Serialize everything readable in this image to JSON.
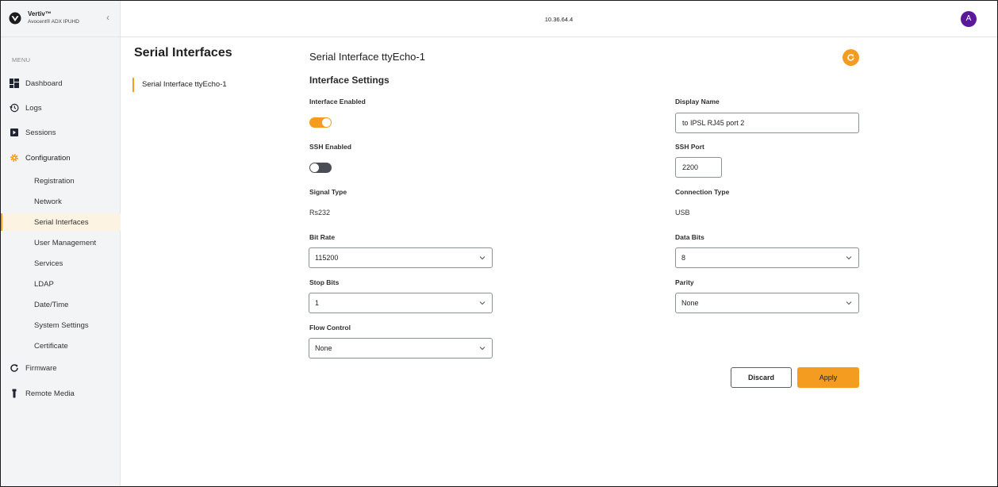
{
  "brand": {
    "name": "Vertiv™",
    "product": "Avocent® ADX IPUHD"
  },
  "topbar": {
    "host": "10.36.64.4",
    "avatar_initial": "A"
  },
  "sidebar": {
    "menu_label": "MENU",
    "items": [
      {
        "label": "Dashboard",
        "icon": "dashboard-icon"
      },
      {
        "label": "Logs",
        "icon": "history-icon"
      },
      {
        "label": "Sessions",
        "icon": "sessions-icon"
      },
      {
        "label": "Configuration",
        "icon": "gear-icon"
      },
      {
        "label": "Firmware",
        "icon": "refresh-icon"
      },
      {
        "label": "Remote Media",
        "icon": "usb-icon"
      }
    ],
    "config_items": [
      "Registration",
      "Network",
      "Serial Interfaces",
      "User Management",
      "Services",
      "LDAP",
      "Date/Time",
      "System Settings",
      "Certificate"
    ],
    "active_item": "Serial Interfaces"
  },
  "page": {
    "section_title": "Serial Interfaces",
    "subnav": [
      "Serial Interface ttyEcho-1"
    ],
    "interface_title": "Serial Interface ttyEcho-1",
    "settings_heading": "Interface Settings"
  },
  "form": {
    "interface_enabled": {
      "label": "Interface Enabled",
      "value": true
    },
    "display_name": {
      "label": "Display Name",
      "value": "to IPSL RJ45 port 2"
    },
    "ssh_enabled": {
      "label": "SSH Enabled",
      "value": false
    },
    "ssh_port": {
      "label": "SSH Port",
      "value": "2200"
    },
    "signal_type": {
      "label": "Signal Type",
      "value": "Rs232"
    },
    "connection_type": {
      "label": "Connection Type",
      "value": "USB"
    },
    "bit_rate": {
      "label": "Bit Rate",
      "value": "115200"
    },
    "data_bits": {
      "label": "Data Bits",
      "value": "8"
    },
    "stop_bits": {
      "label": "Stop Bits",
      "value": "1"
    },
    "parity": {
      "label": "Parity",
      "value": "None"
    },
    "flow_control": {
      "label": "Flow Control",
      "value": "None"
    }
  },
  "actions": {
    "discard": "Discard",
    "apply": "Apply"
  },
  "colors": {
    "accent": "#f39c1f",
    "avatar": "#5a189a",
    "toggle_off": "#4a4d55",
    "active_bg": "#fcf3e3"
  }
}
